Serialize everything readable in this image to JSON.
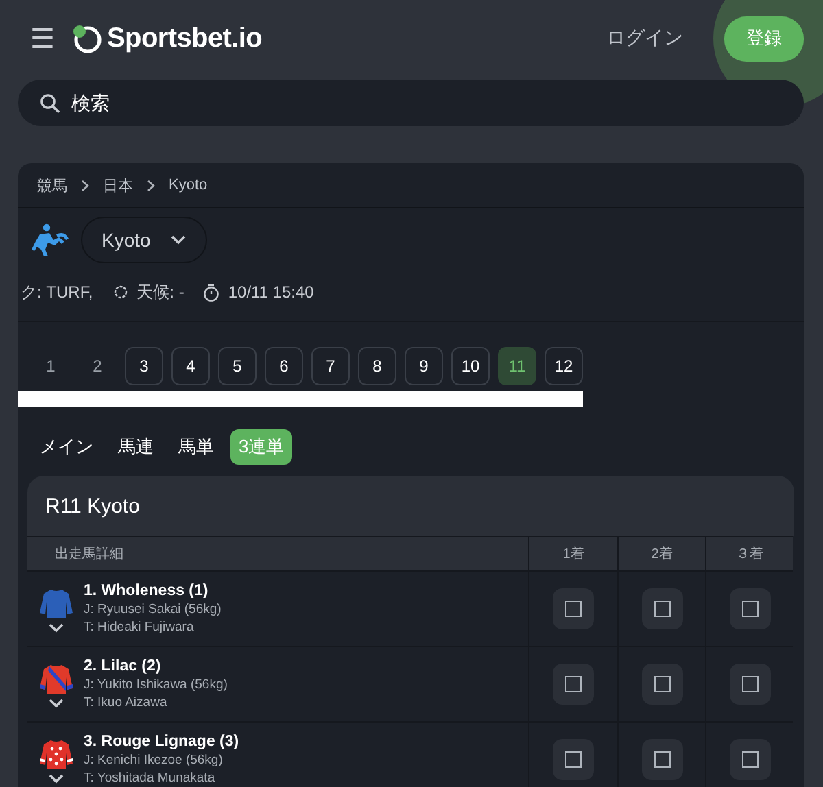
{
  "header": {
    "menu_icon": "☰",
    "brand": "Sportsbet.io",
    "login": "ログイン",
    "register": "登録"
  },
  "search": {
    "placeholder": "検索"
  },
  "breadcrumb": [
    "競馬",
    "日本",
    "Kyoto"
  ],
  "venue": {
    "name": "Kyoto"
  },
  "info": {
    "track": "ク: TURF,",
    "weather": "天候: -",
    "time": "10/11 15:40"
  },
  "races": [
    {
      "label": "1",
      "disabled": true,
      "selected": false
    },
    {
      "label": "2",
      "disabled": true,
      "selected": false
    },
    {
      "label": "3",
      "disabled": false,
      "selected": false
    },
    {
      "label": "4",
      "disabled": false,
      "selected": false
    },
    {
      "label": "5",
      "disabled": false,
      "selected": false
    },
    {
      "label": "6",
      "disabled": false,
      "selected": false
    },
    {
      "label": "7",
      "disabled": false,
      "selected": false
    },
    {
      "label": "8",
      "disabled": false,
      "selected": false
    },
    {
      "label": "9",
      "disabled": false,
      "selected": false
    },
    {
      "label": "10",
      "disabled": false,
      "selected": false
    },
    {
      "label": "11",
      "disabled": false,
      "selected": true
    },
    {
      "label": "12",
      "disabled": false,
      "selected": false
    }
  ],
  "tabs": [
    {
      "label": "メイン",
      "selected": false
    },
    {
      "label": "馬連",
      "selected": false
    },
    {
      "label": "馬単",
      "selected": false
    },
    {
      "label": "3連単",
      "selected": true
    }
  ],
  "race": {
    "title": "R11 Kyoto",
    "columns": [
      "出走馬詳細",
      "1着",
      "2着",
      "３着"
    ],
    "runners": [
      {
        "name": "1. Wholeness (1)",
        "jockey": "J: Ryuusei Sakai (56kg)",
        "trainer": "T: Hideaki Fujiwara",
        "kind": "solid",
        "picks": [
          {
            "checked": false
          },
          {
            "checked": false
          },
          {
            "checked": false
          }
        ]
      },
      {
        "name": "2. Lilac (2)",
        "jockey": "J: Yukito Ishikawa (56kg)",
        "trainer": "T: Ikuo Aizawa",
        "kind": "sash",
        "picks": [
          {
            "checked": false
          },
          {
            "checked": false
          },
          {
            "checked": false
          }
        ]
      },
      {
        "name": "3. Rouge Lignage (3)",
        "jockey": "J: Kenichi Ikezoe (56kg)",
        "trainer": "T: Yoshitada Munakata",
        "kind": "stars",
        "picks": [
          {
            "checked": false
          },
          {
            "checked": false
          },
          {
            "checked": false
          }
        ]
      }
    ]
  }
}
